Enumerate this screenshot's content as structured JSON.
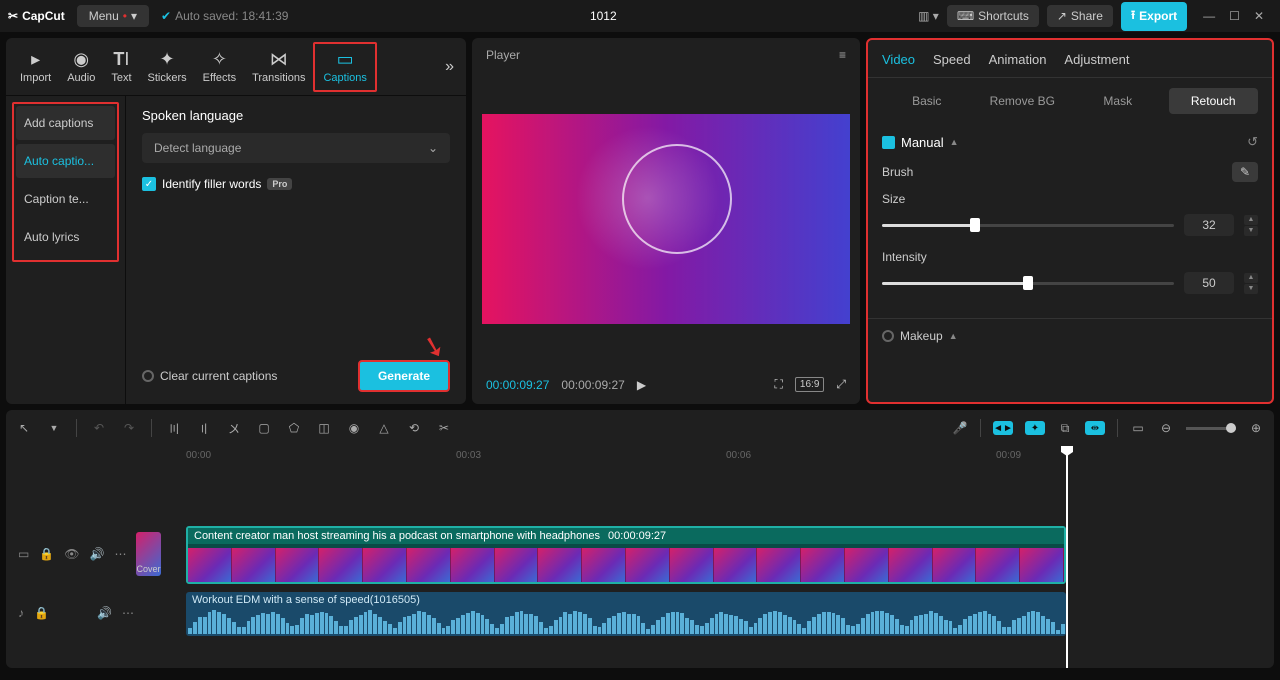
{
  "app": {
    "name": "CapCut",
    "menu": "Menu",
    "autosave": "Auto saved: 18:41:39",
    "project": "1012"
  },
  "titlebar": {
    "shortcuts": "Shortcuts",
    "share": "Share",
    "export": "Export"
  },
  "mediaTabs": {
    "import": "Import",
    "audio": "Audio",
    "text": "Text",
    "stickers": "Stickers",
    "effects": "Effects",
    "transitions": "Transitions",
    "captions": "Captions"
  },
  "captionSidebar": {
    "add": "Add captions",
    "auto": "Auto captio...",
    "template": "Caption te...",
    "lyrics": "Auto lyrics"
  },
  "captionPanel": {
    "spokenLang": "Spoken language",
    "detect": "Detect language",
    "filler": "Identify filler words",
    "pro": "Pro",
    "clear": "Clear current captions",
    "generate": "Generate"
  },
  "player": {
    "title": "Player",
    "tc1": "00:00:09:27",
    "tc2": "00:00:09:27",
    "ratio": "16:9"
  },
  "rightTabs": {
    "video": "Video",
    "speed": "Speed",
    "animation": "Animation",
    "adjustment": "Adjustment"
  },
  "subTabs": {
    "basic": "Basic",
    "removebg": "Remove BG",
    "mask": "Mask",
    "retouch": "Retouch"
  },
  "retouch": {
    "manual": "Manual",
    "brush": "Brush",
    "size": "Size",
    "sizeVal": "32",
    "intensity": "Intensity",
    "intensityVal": "50",
    "makeup": "Makeup"
  },
  "ruler": [
    "00:00",
    "00:03",
    "00:06",
    "00:09"
  ],
  "videoClip": {
    "title": "Content creator man host streaming his a podcast on smartphone with headphones",
    "dur": "00:00:09:27"
  },
  "audioClip": {
    "title": "Workout EDM with a sense of speed(1016505)"
  },
  "cover": "Cover"
}
